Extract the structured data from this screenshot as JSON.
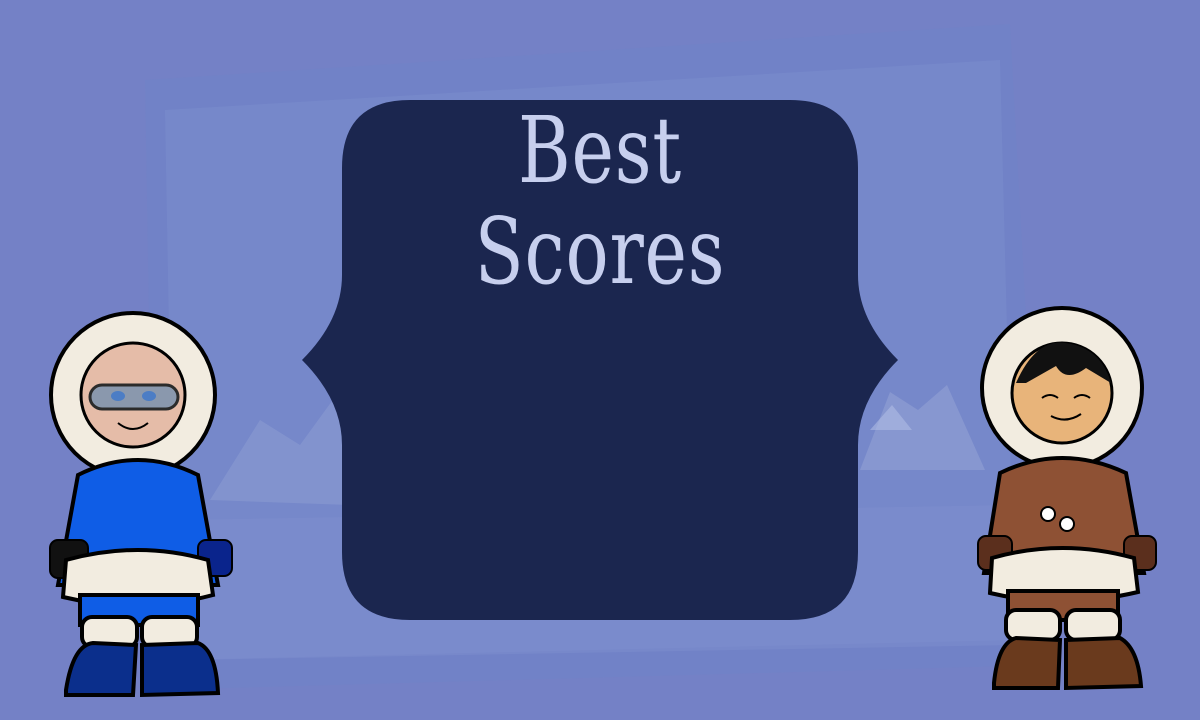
{
  "title": "Best Scores",
  "scores": [],
  "colors": {
    "background": "#7481c6",
    "panel": "#1b264f",
    "title_text": "#c7cfee",
    "character_left_suit": "#0f5de6",
    "character_right_suit": "#8e5134"
  }
}
